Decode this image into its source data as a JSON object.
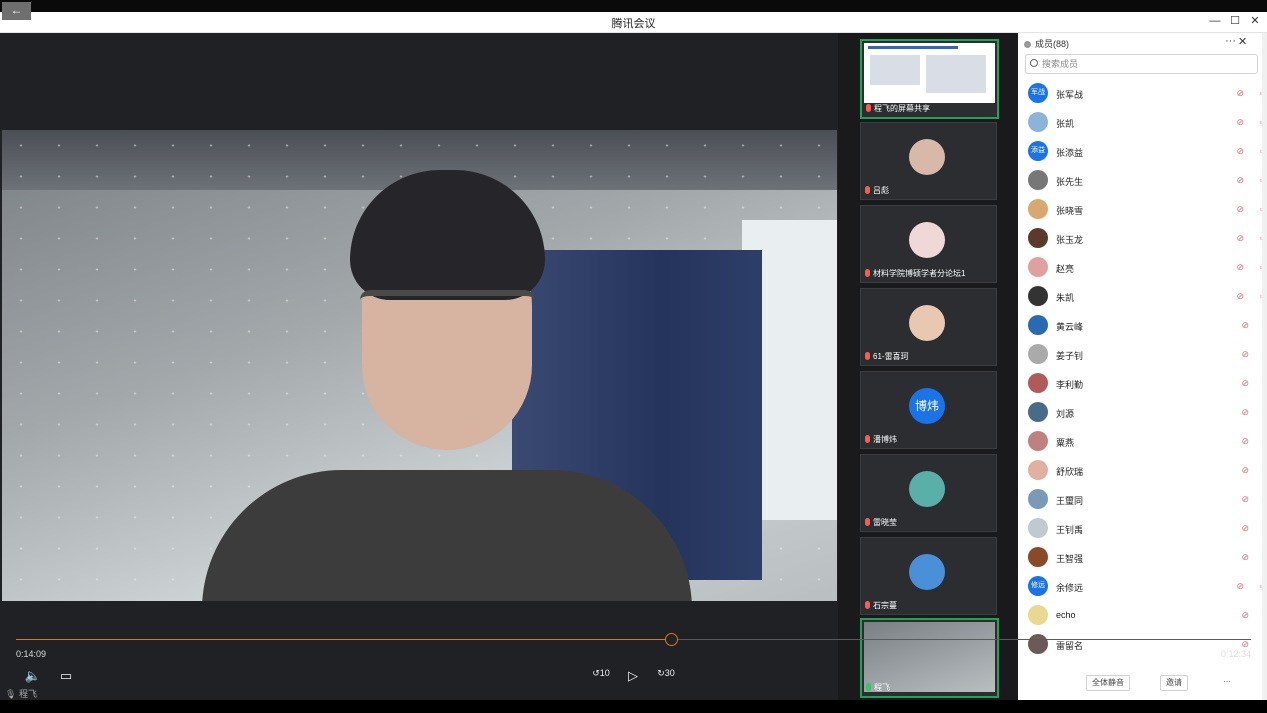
{
  "window": {
    "title": "腾讯会议",
    "back_icon": "←",
    "minimize_icon": "—",
    "maximize_icon": "☐",
    "close_icon": "✕"
  },
  "player": {
    "current_time": "0:14:09",
    "total_time": "0:12:34",
    "progress": 0.53,
    "rewind_label": "10",
    "forward_label": "30",
    "self_name": "程飞",
    "accent": "#d27c1d"
  },
  "gallery": {
    "tiles": [
      {
        "name": "程飞的屏幕共享",
        "type": "screenshare"
      },
      {
        "name": "吕彪"
      },
      {
        "name": "材料学院博硕学者分论坛1"
      },
      {
        "name": "61-雷喜珂"
      },
      {
        "name": "潘博炜",
        "avatar_text": "博炜"
      },
      {
        "name": "雷晓莹"
      },
      {
        "name": "石宗蔓"
      },
      {
        "name": "程飞"
      }
    ]
  },
  "members": {
    "title": "成员(88)",
    "more_icon": "···",
    "close_icon": "✕",
    "search_placeholder": "搜索成员",
    "list": [
      {
        "name": "张军战",
        "avatar_text": "军战",
        "color": "#1a73e8",
        "cam": true
      },
      {
        "name": "张凯",
        "avatar_text": "",
        "color": "#8ab4d8",
        "cam": true
      },
      {
        "name": "张添益",
        "avatar_text": "添益",
        "color": "#1a73e8",
        "cam": true
      },
      {
        "name": "张先生",
        "avatar_text": "",
        "color": "#777",
        "cam": true
      },
      {
        "name": "张晓雪",
        "avatar_text": "",
        "color": "#d8a870",
        "cam": true
      },
      {
        "name": "张玉龙",
        "avatar_text": "",
        "color": "#5a3a2a",
        "cam": true
      },
      {
        "name": "赵亮",
        "avatar_text": "",
        "color": "#e0a0a0",
        "cam": true
      },
      {
        "name": "朱凯",
        "avatar_text": "",
        "color": "#333",
        "cam": true
      },
      {
        "name": "黄云峰",
        "avatar_text": "",
        "color": "#2a6ab0",
        "cam": false
      },
      {
        "name": "姜子钊",
        "avatar_text": "",
        "color": "#aaa",
        "cam": false
      },
      {
        "name": "李利勤",
        "avatar_text": "",
        "color": "#b05a5a",
        "cam": false
      },
      {
        "name": "刘源",
        "avatar_text": "",
        "color": "#4a6a8a",
        "cam": false
      },
      {
        "name": "粟燕",
        "avatar_text": "",
        "color": "#c08080",
        "cam": false
      },
      {
        "name": "舒欣瑞",
        "avatar_text": "",
        "color": "#e0b0a0",
        "cam": false
      },
      {
        "name": "王璽同",
        "avatar_text": "",
        "color": "#7a9ab8",
        "cam": false
      },
      {
        "name": "王钊禹",
        "avatar_text": "",
        "color": "#c0c8d0",
        "cam": false
      },
      {
        "name": "王智强",
        "avatar_text": "",
        "color": "#8a4a2a",
        "cam": false
      },
      {
        "name": "余修远",
        "avatar_text": "修远",
        "color": "#1a73e8",
        "cam": true
      },
      {
        "name": "echo",
        "avatar_text": "",
        "color": "#e8d890",
        "cam": false
      },
      {
        "name": "雷留名",
        "avatar_text": "",
        "color": "#6a5a5a",
        "cam": false
      }
    ],
    "footer": {
      "mute_all": "全体静音",
      "invite": "邀请",
      "more": "···"
    }
  }
}
